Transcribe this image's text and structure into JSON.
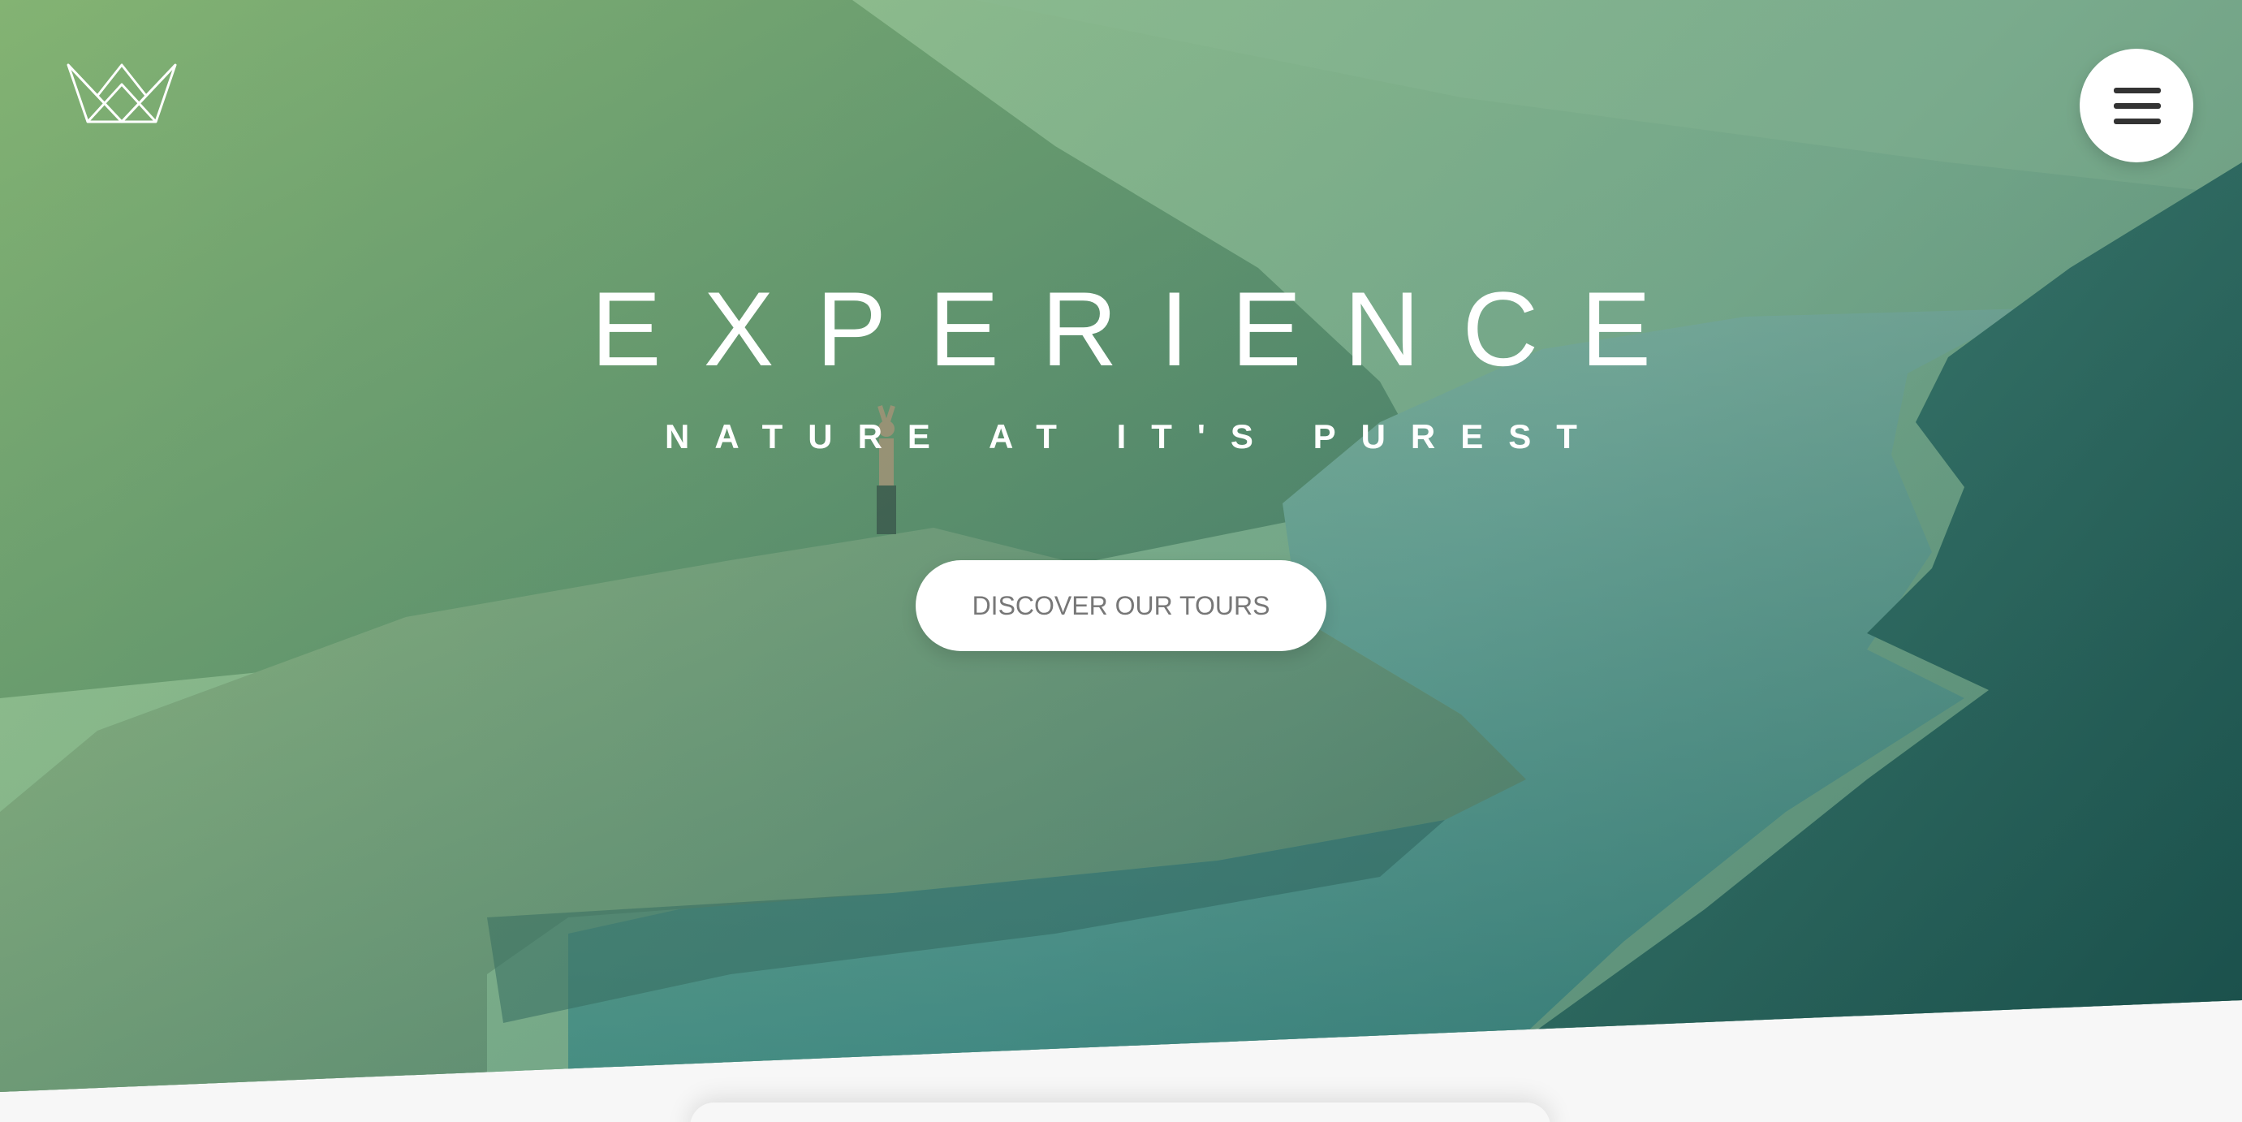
{
  "hero": {
    "headline": "EXPERIENCE",
    "subheadline": "NATURE AT IT'S PUREST",
    "cta_label": "DISCOVER OUR TOURS"
  },
  "header": {
    "logo_icon": "crown-icon",
    "menu_icon": "hamburger-menu-icon"
  },
  "colors": {
    "overlay_light": "#8fbf8a",
    "overlay_dark": "#1e5650",
    "button_bg": "#ffffff",
    "button_text": "#777777",
    "page_bg": "#f7f7f7"
  }
}
